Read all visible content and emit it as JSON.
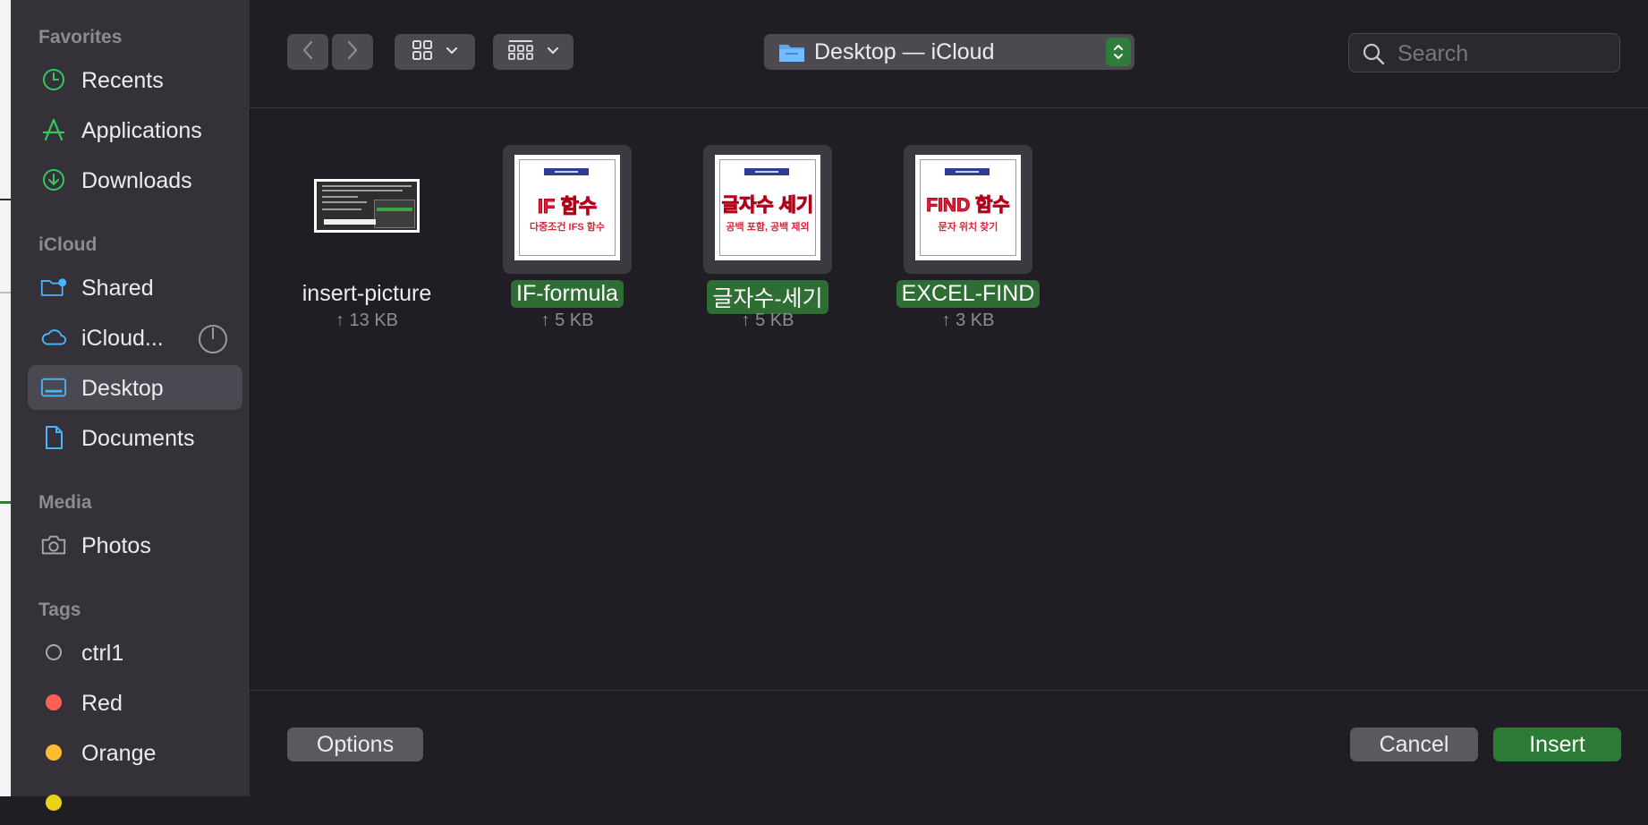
{
  "sidebar": {
    "sections": [
      {
        "title": "Favorites"
      },
      {
        "title": "iCloud"
      },
      {
        "title": "Media"
      },
      {
        "title": "Tags"
      }
    ],
    "favorites": [
      {
        "label": "Recents",
        "icon": "clock-icon"
      },
      {
        "label": "Applications",
        "icon": "applications-icon"
      },
      {
        "label": "Downloads",
        "icon": "download-icon"
      }
    ],
    "icloud": [
      {
        "label": "Shared",
        "icon": "shared-folder-icon"
      },
      {
        "label": "iCloud...",
        "icon": "cloud-icon"
      },
      {
        "label": "Desktop",
        "icon": "desktop-icon",
        "selected": true
      },
      {
        "label": "Documents",
        "icon": "document-icon"
      }
    ],
    "media": [
      {
        "label": "Photos",
        "icon": "camera-icon"
      }
    ],
    "tags": [
      {
        "label": "ctrl1",
        "color": ""
      },
      {
        "label": "Red",
        "color": "#ff5f57"
      },
      {
        "label": "Orange",
        "color": "#febc2e"
      }
    ]
  },
  "toolbar": {
    "location": "Desktop — iCloud",
    "search_placeholder": "Search"
  },
  "files": [
    {
      "name": "insert-picture",
      "meta": "↑ 13 KB",
      "selected": false
    },
    {
      "name": "IF-formula",
      "meta": "↑ 5 KB",
      "selected": true,
      "thumb_title": "IF 함수",
      "thumb_sub": "다중조건 IFS 함수"
    },
    {
      "name": "글자수-세기",
      "meta": "↑ 5 KB",
      "selected": true,
      "thumb_title": "글자수 세기",
      "thumb_sub": "공백 포함, 공백 제외"
    },
    {
      "name": "EXCEL-FIND",
      "meta": "↑ 3 KB",
      "selected": true,
      "thumb_title": "FIND 함수",
      "thumb_sub": "문자 위치 찾기"
    }
  ],
  "footer": {
    "options_label": "Options",
    "cancel_label": "Cancel",
    "insert_label": "Insert"
  },
  "colors": {
    "accent": "#2b7a36",
    "sidebar_bg": "#343238",
    "content_bg": "#201e24"
  }
}
